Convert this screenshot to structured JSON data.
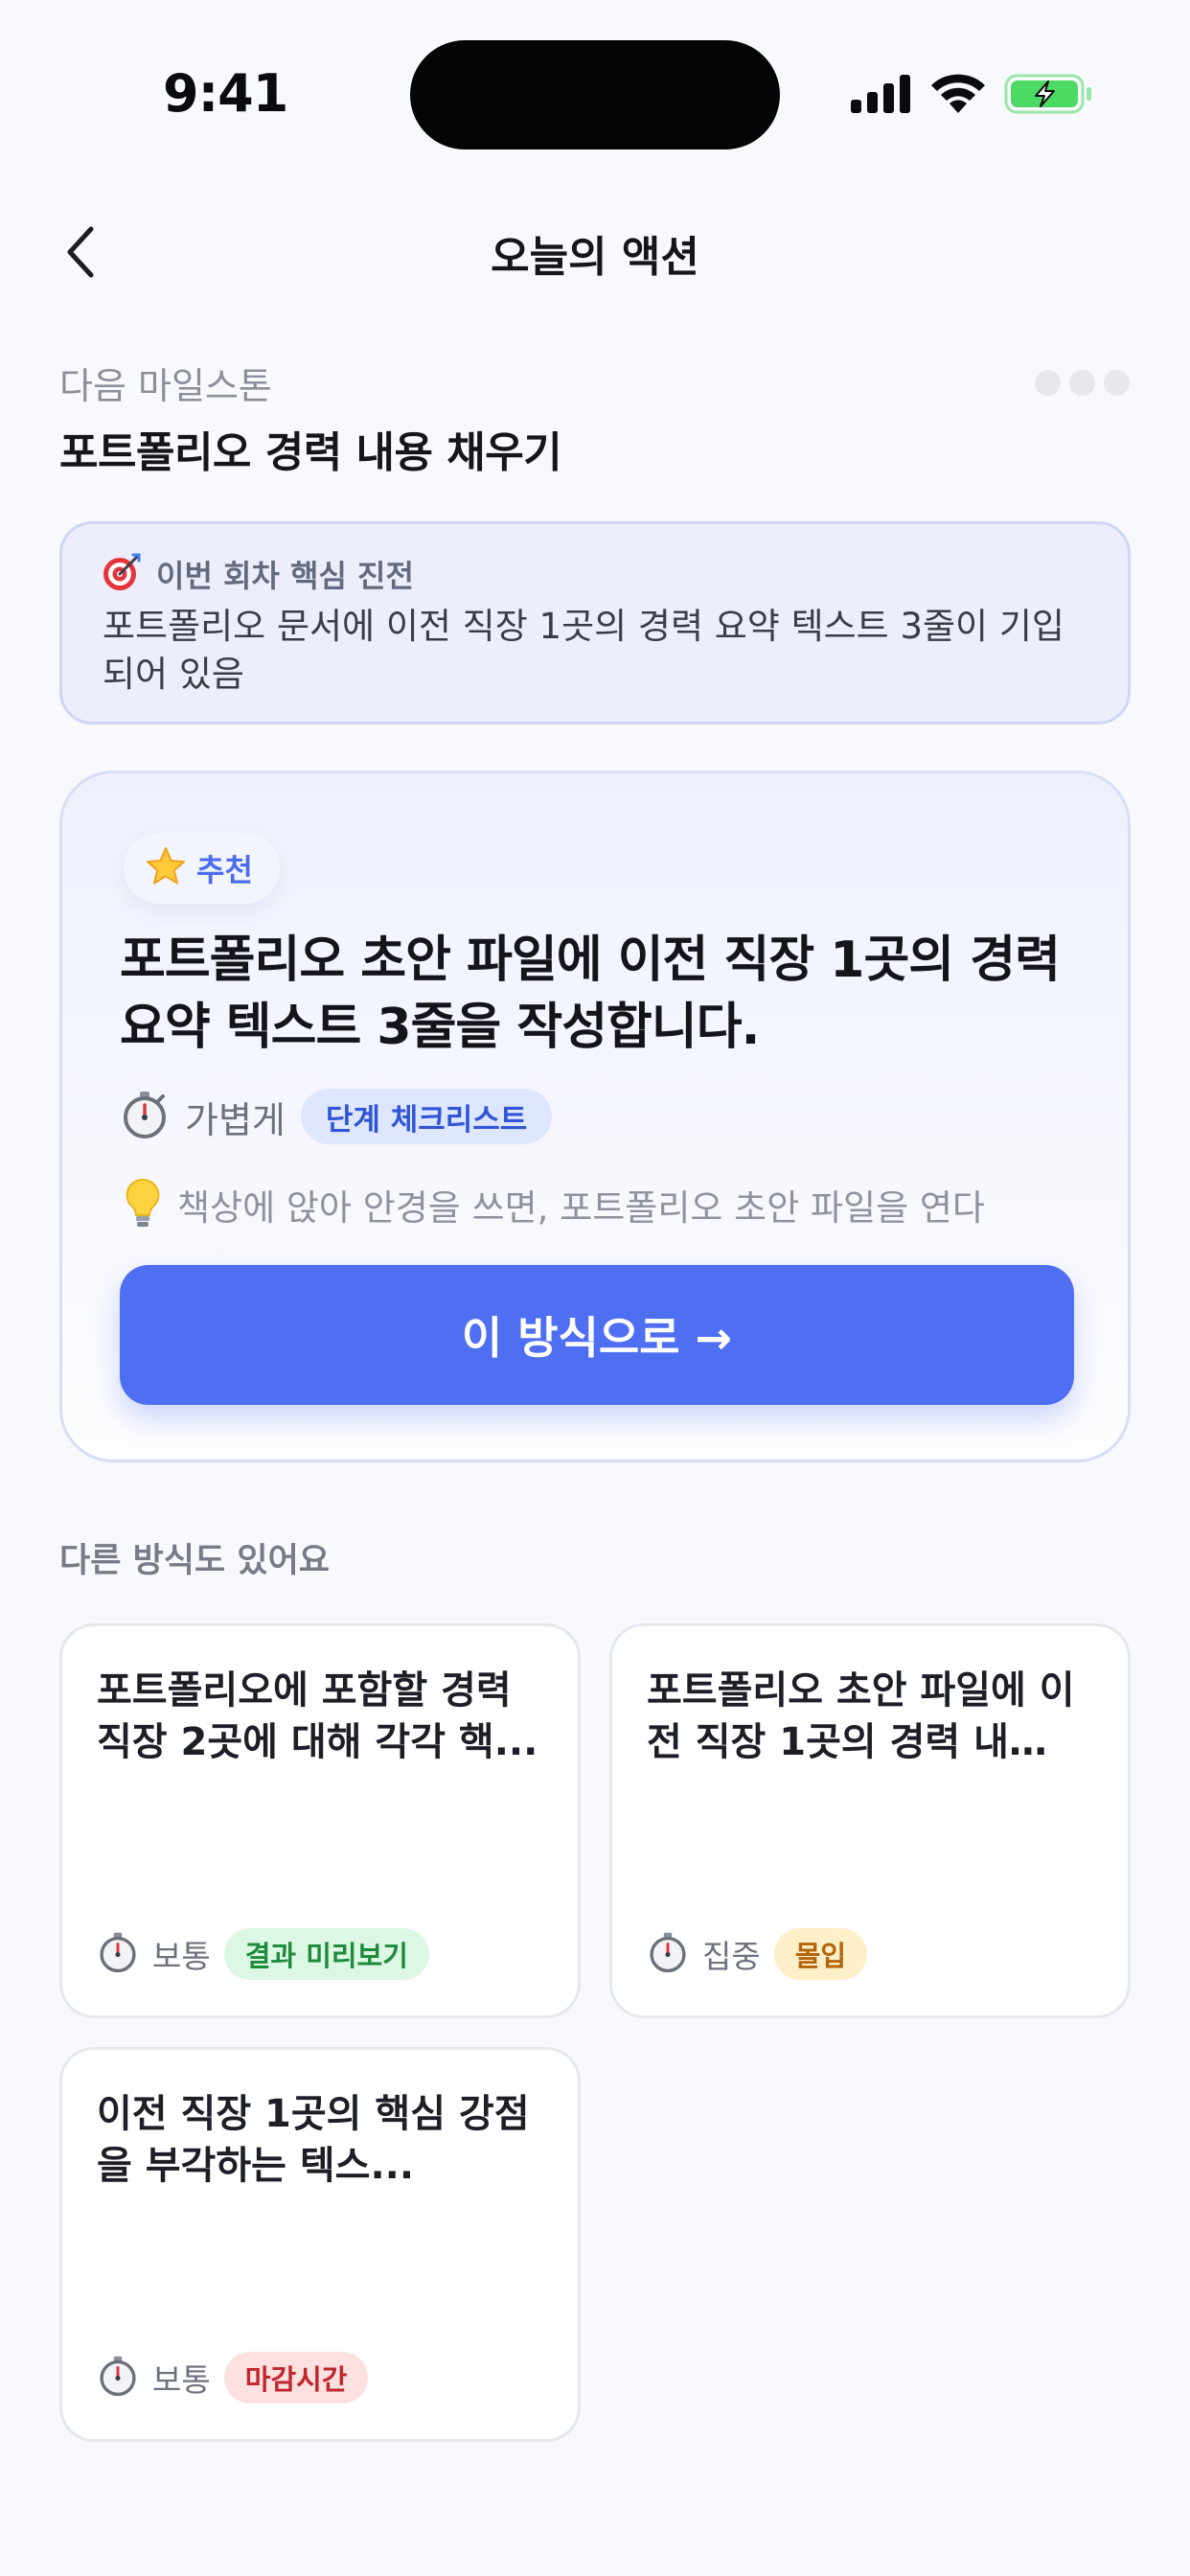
{
  "status_bar": {
    "time": "9:41",
    "icons": [
      "signal-icon",
      "wifi-icon",
      "battery-charging-icon"
    ],
    "battery_color": "#4cd964"
  },
  "nav": {
    "back_icon": "chevron-left-icon",
    "title": "오늘의 액션"
  },
  "milestone": {
    "label": "다음 마일스톤",
    "title": "포트폴리오 경력 내용 채우기",
    "progress_dots": 3
  },
  "core_progress": {
    "icon": "target-icon",
    "label": "이번 회차 핵심 진전",
    "text": "포트폴리오 문서에 이전 직장 1곳의 경력 요약 텍스트 3줄이 기입되어 있음"
  },
  "recommended": {
    "badge_icon": "star-icon",
    "badge_label": "추천",
    "title": "포트폴리오 초안 파일에 이전 직장 1곳의 경력 요약 텍스트 3줄을 작성합니다.",
    "effort_icon": "stopwatch-icon",
    "effort": "가볍게",
    "tag": "단계 체크리스트",
    "tip_icon": "lightbulb-icon",
    "tip": "책상에 앉아 안경을 쓰면, 포트폴리오 초안 파일을 연다",
    "cta": "이 방식으로 →",
    "accent_color": "#4f6ff2"
  },
  "alternatives": {
    "heading": "다른 방식도 있어요",
    "items": [
      {
        "title": "포트폴리오에 포함할 경력 직장 2곳에 대해 각각 핵...",
        "effort": "보통",
        "tag": "결과 미리보기",
        "tag_color": "green"
      },
      {
        "title": "포트폴리오 초안 파일에 이전 직장 1곳의 경력 내…",
        "effort": "집중",
        "tag": "몰입",
        "tag_color": "yellow"
      },
      {
        "title": "이전 직장 1곳의 핵심 강점을 부각하는 텍스...",
        "effort": "보통",
        "tag": "마감시간",
        "tag_color": "red"
      }
    ]
  }
}
